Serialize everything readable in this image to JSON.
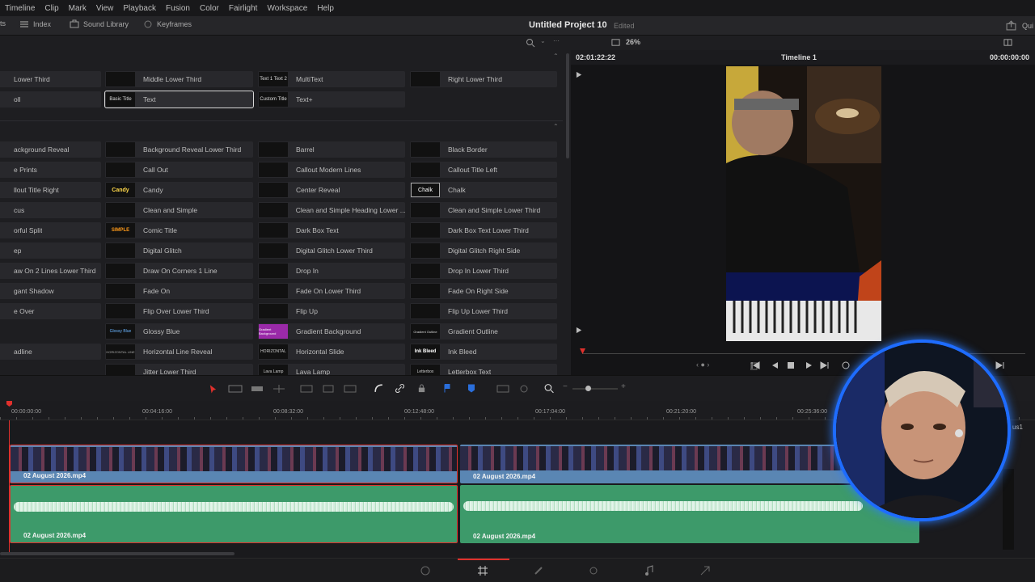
{
  "menu": [
    "Timeline",
    "Clip",
    "Mark",
    "View",
    "Playback",
    "Fusion",
    "Color",
    "Fairlight",
    "Workspace",
    "Help"
  ],
  "toolbar": {
    "left_stub": "ts",
    "index": "Index",
    "sound_library": "Sound Library",
    "keyframes": "Keyframes",
    "project_title": "Untitled Project 10",
    "project_status": "Edited",
    "zoom": "26%",
    "right_stub": "Qui"
  },
  "effects": {
    "section1": [
      [
        "Lower Third",
        "Middle Lower Third",
        "MultiText",
        "Right Lower Third"
      ],
      [
        "oll",
        "Text",
        "Text+",
        ""
      ]
    ],
    "section1_thumbs": [
      "",
      "",
      "Text 1\nText 2",
      "",
      "",
      "Basic Title",
      "Custom Title",
      ""
    ],
    "section2": [
      [
        "ackground Reveal",
        "Background Reveal Lower Third",
        "Barrel",
        "Black Border"
      ],
      [
        "e Prints",
        "Call Out",
        "Callout Modern Lines",
        "Callout Title Left"
      ],
      [
        "llout Title Right",
        "Candy",
        "Center Reveal",
        "Chalk"
      ],
      [
        "cus",
        "Clean and Simple",
        "Clean and Simple Heading Lower ...",
        "Clean and Simple Lower Third"
      ],
      [
        "orful Split",
        "Comic Title",
        "Dark Box Text",
        "Dark Box Text Lower Third"
      ],
      [
        "ep",
        "Digital Glitch",
        "Digital Glitch Lower Third",
        "Digital Glitch Right Side"
      ],
      [
        "aw On 2 Lines Lower Third",
        "Draw On Corners 1 Line",
        "Drop In",
        "Drop In Lower Third"
      ],
      [
        "gant Shadow",
        "Fade On",
        "Fade On Lower Third",
        "Fade On Right Side"
      ],
      [
        "e Over",
        "Flip Over Lower Third",
        "Flip Up",
        "Flip Up Lower Third"
      ],
      [
        "",
        "Glossy Blue",
        "Gradient Background",
        "Gradient Outline"
      ],
      [
        "adline",
        "Horizontal Line Reveal",
        "Horizontal Slide",
        "Ink Bleed"
      ],
      [
        "",
        "Jitter Lower Third",
        "Lava Lamp",
        "Letterbox Text"
      ]
    ],
    "section2_thumbs": {
      "candy": "Candy",
      "chalk": "Chalk",
      "comic": "SIMPLE",
      "glossy": "Glossy Blue",
      "gradient_bg": "Gradient Background",
      "gradient_outline": "Gradient Outline",
      "horizontal_line": "HORIZONTAL LINE",
      "horizontal_slide": "HORIZONTAL",
      "ink_bleed": "Ink Bleed",
      "lava": "Lava Lamp",
      "letterbox": "Letterbox"
    }
  },
  "viewer": {
    "timecode_left": "02:01:22:22",
    "timeline_name": "Timeline 1",
    "timecode_right": "00:00:00:00"
  },
  "timeline": {
    "ruler": [
      "00:00:00:00",
      "00:04:16:00",
      "00:08:32:00",
      "00:12:48:00",
      "00:17:04:00",
      "00:21:20:00",
      "00:25:36:00"
    ],
    "clips": {
      "video1": "02 August 2026.mp4",
      "video2": "02 August 2026.mp4",
      "audio1": "02 August 2026.mp4",
      "audio2": "02 August 2026.mp4"
    },
    "right_stub": "us1"
  },
  "colors": {
    "video_clip": "#5a86b3",
    "audio_clip": "#3d9a6a",
    "playhead": "#e0302c",
    "webcam_ring": "#1e6cff"
  }
}
